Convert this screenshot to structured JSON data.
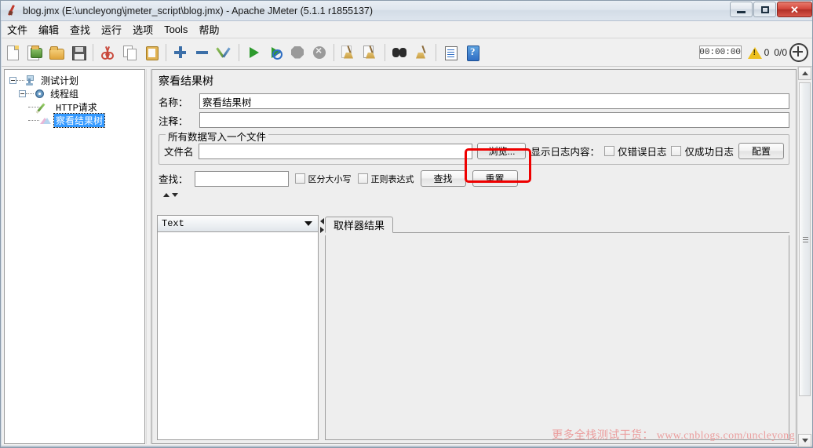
{
  "window": {
    "title": "blog.jmx (E:\\uncleyong\\jmeter_script\\blog.jmx) - Apache JMeter (5.1.1 r1855137)",
    "app_icon": "jmeter-feather-icon",
    "caption": {
      "minimize": "minimize-button",
      "restore": "restore-button",
      "close": "✕"
    }
  },
  "menubar": {
    "items": [
      {
        "label": "文件",
        "name": "menu-file"
      },
      {
        "label": "编辑",
        "name": "menu-edit"
      },
      {
        "label": "查找",
        "name": "menu-search"
      },
      {
        "label": "运行",
        "name": "menu-run"
      },
      {
        "label": "选项",
        "name": "menu-options"
      },
      {
        "label": "Tools",
        "name": "menu-tools"
      },
      {
        "label": "帮助",
        "name": "menu-help"
      }
    ]
  },
  "toolbar": {
    "buttons": [
      {
        "name": "new-button",
        "icon": "new-document-icon"
      },
      {
        "name": "templates-button",
        "icon": "templates-icon"
      },
      {
        "name": "open-button",
        "icon": "open-folder-icon"
      },
      {
        "name": "save-button",
        "icon": "save-disk-icon"
      },
      {
        "sep": true
      },
      {
        "name": "cut-button",
        "icon": "scissors-icon"
      },
      {
        "name": "copy-button",
        "icon": "copy-icon"
      },
      {
        "name": "paste-button",
        "icon": "clipboard-icon"
      },
      {
        "sep": true
      },
      {
        "name": "expand-button",
        "icon": "plus-icon"
      },
      {
        "name": "collapse-button",
        "icon": "minus-icon"
      },
      {
        "name": "toggle-button",
        "icon": "toggle-pencils-icon"
      },
      {
        "sep": true
      },
      {
        "name": "start-button",
        "icon": "play-green-icon"
      },
      {
        "name": "start-no-pauses-button",
        "icon": "play-no-timer-icon"
      },
      {
        "name": "stop-button",
        "icon": "stop-octagon-icon"
      },
      {
        "name": "shutdown-button",
        "icon": "shutdown-circle-icon"
      },
      {
        "sep": true
      },
      {
        "name": "clear-button",
        "icon": "broom-icon"
      },
      {
        "name": "clear-all-button",
        "icon": "broom-page-icon"
      },
      {
        "sep": true
      },
      {
        "name": "search-button",
        "icon": "binoculars-icon"
      },
      {
        "name": "reset-search-button",
        "icon": "broom-reset-icon"
      },
      {
        "sep": true
      },
      {
        "name": "function-helper-button",
        "icon": "function-list-icon"
      },
      {
        "name": "help-button",
        "icon": "help-book-icon"
      }
    ],
    "timer": "00:00:00",
    "warning_icon": "warning-triangle-icon",
    "warning_count": "0",
    "threads": "0/0",
    "nav_icon": "expand-collapse-icon"
  },
  "tree": {
    "nodes": [
      {
        "label": "测试计划",
        "icon": "test-plan-icon",
        "name": "tree-node-test-plan",
        "selected": false
      },
      {
        "label": "线程组",
        "icon": "thread-group-icon",
        "name": "tree-node-thread-group",
        "selected": false
      },
      {
        "label": "HTTP请求",
        "icon": "http-request-icon",
        "name": "tree-node-http-request",
        "selected": false
      },
      {
        "label": "察看结果树",
        "icon": "view-results-tree-icon",
        "name": "tree-node-view-results-tree",
        "selected": true
      }
    ]
  },
  "panel": {
    "title": "察看结果树",
    "name_label": "名称：",
    "name_value": "察看结果树",
    "comment_label": "注释：",
    "comment_value": "",
    "filegroup": {
      "title": "所有数据写入一个文件",
      "filename_label": "文件名",
      "filename_value": "",
      "browse_button": "浏览...",
      "log_display_label": "显示日志内容：",
      "errors_only": "仅错误日志",
      "errors_only_checked": false,
      "success_only": "仅成功日志",
      "success_only_checked": false,
      "configure_button": "配置"
    },
    "search": {
      "label": "查找：",
      "value": "",
      "case_sensitive": "区分大小写",
      "case_sensitive_checked": false,
      "regex": "正则表达式",
      "regex_checked": false,
      "find_button": "查找",
      "reset_button": "重置"
    },
    "renderer": {
      "selected": "Text"
    },
    "tabs": [
      {
        "label": "取样器结果",
        "name": "tab-sampler-result",
        "active": true
      }
    ]
  },
  "annotation": {
    "color": "#ee0000",
    "target": "browse-button-highlight"
  },
  "watermark": "更多全栈测试干货： www.cnblogs.com/uncleyong"
}
